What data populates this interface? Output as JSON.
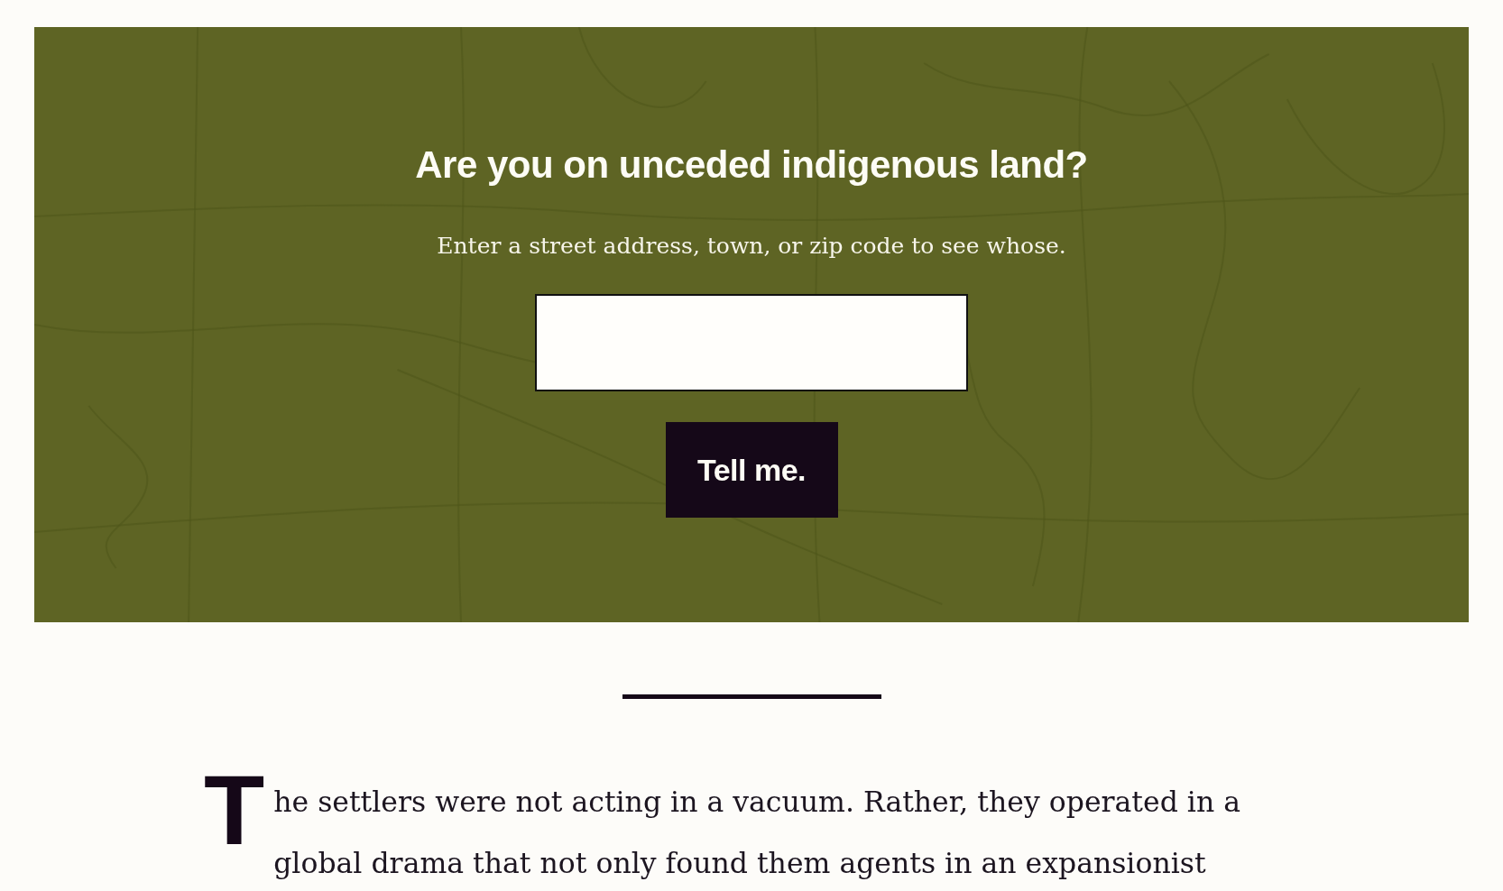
{
  "banner": {
    "title": "Are you on unceded indigenous land?",
    "subtitle": "Enter a street address, town, or zip code to see whose.",
    "button": "Tell me."
  },
  "article": {
    "drop_cap": "T",
    "paragraph": "he settlers were not acting in a vacuum. Rather, they operated in a global drama that not only found them agents in an expansionist"
  }
}
